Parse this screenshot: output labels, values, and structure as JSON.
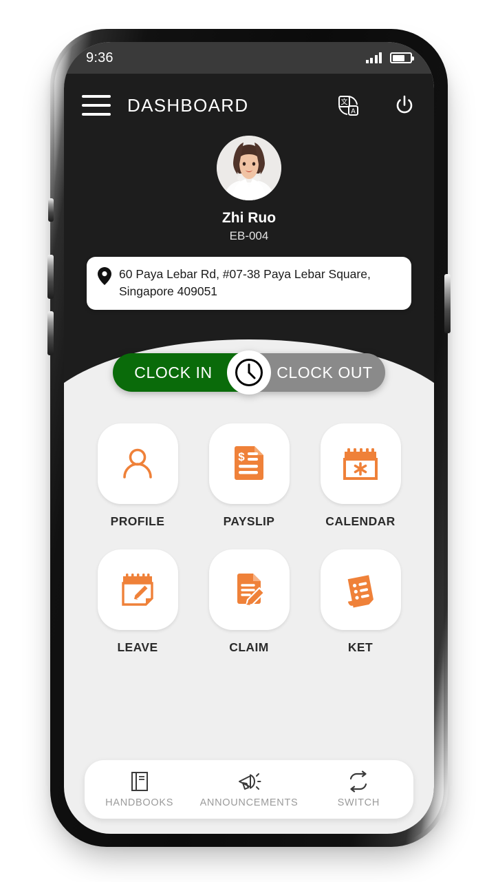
{
  "statusbar": {
    "time": "9:36",
    "signal_icon": "signal-bars-icon",
    "battery_icon": "battery-icon",
    "battery_level": "62%"
  },
  "appbar": {
    "menu_icon": "hamburger-menu-icon",
    "title": "DASHBOARD",
    "translate_icon": "translate-icon",
    "power_icon": "power-icon"
  },
  "profile": {
    "avatar_icon": "user-avatar",
    "name": "Zhi Ruo",
    "employee_id": "EB-004",
    "location_icon": "location-pin-icon",
    "address": "60 Paya Lebar Rd, #07-38 Paya Lebar Square, Singapore 409051"
  },
  "attendance": {
    "clock_in_label": "CLOCK IN",
    "clock_out_label": "CLOCK OUT",
    "knob_icon": "clock-icon",
    "clock_in_color": "#0a6b0a",
    "clock_out_color": "#8a8a8a"
  },
  "menu": {
    "accent_color": "#ef8139",
    "tiles": [
      {
        "label": "PROFILE",
        "icon": "person-icon"
      },
      {
        "label": "PAYSLIP",
        "icon": "payslip-document-icon"
      },
      {
        "label": "CALENDAR",
        "icon": "calendar-icon"
      },
      {
        "label": "LEAVE",
        "icon": "notepad-pencil-icon"
      },
      {
        "label": "CLAIM",
        "icon": "document-pencil-icon"
      },
      {
        "label": "KET",
        "icon": "checklist-icon"
      }
    ]
  },
  "bottom_nav": {
    "items": [
      {
        "label": "HANDBOOKS",
        "icon": "book-icon"
      },
      {
        "label": "ANNOUNCEMENTS",
        "icon": "megaphone-icon"
      },
      {
        "label": "SWITCH",
        "icon": "switch-arrows-icon"
      }
    ]
  }
}
